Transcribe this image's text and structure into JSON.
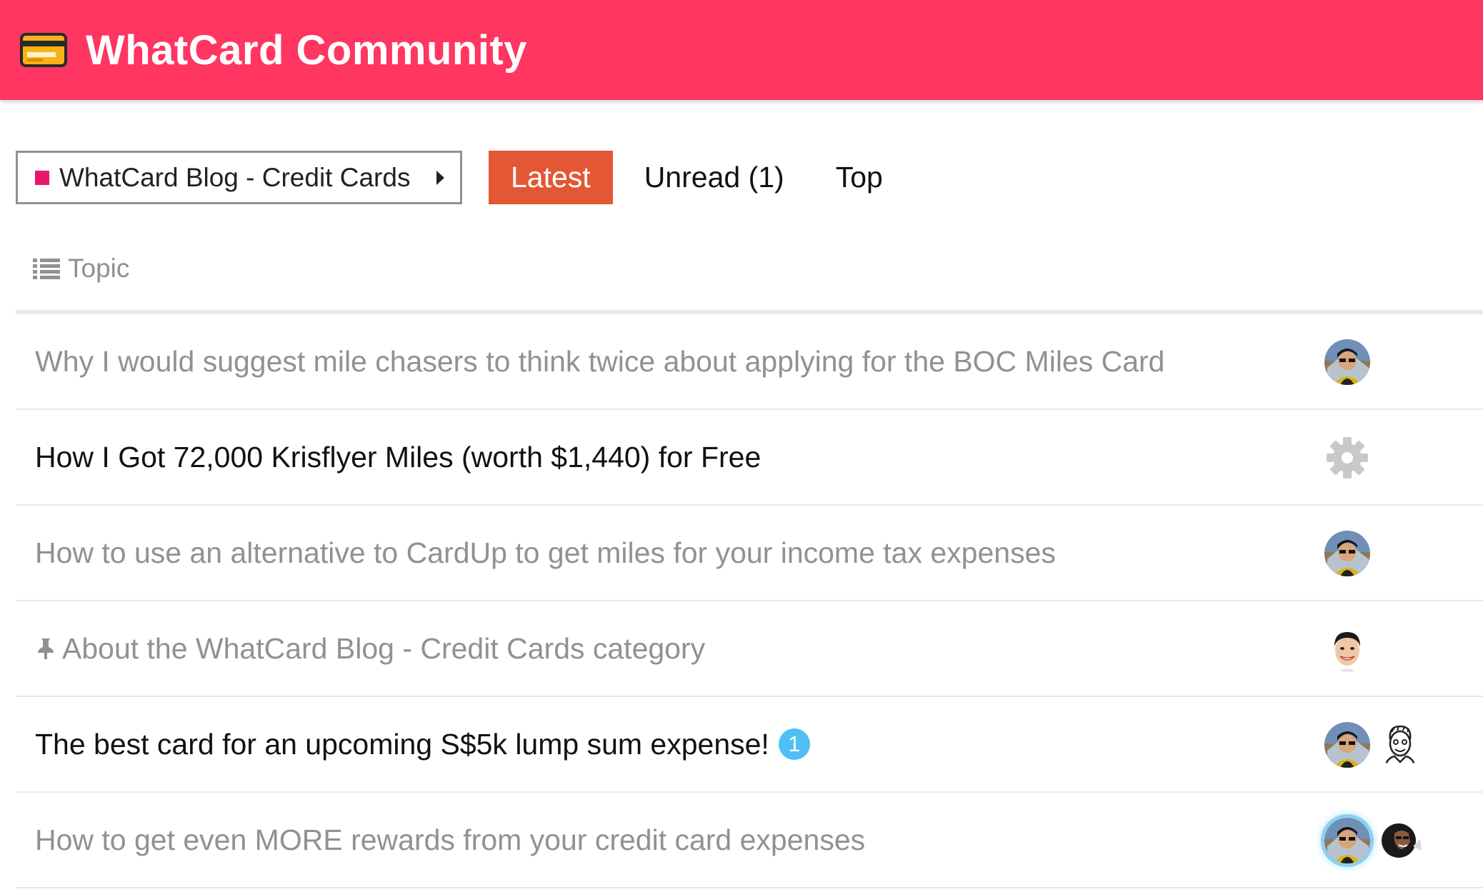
{
  "site": {
    "title": "WhatCard Community",
    "logo_icon": "credit-card-icon",
    "brand_color": "#ff3562"
  },
  "nav": {
    "category": {
      "label": "WhatCard Blog - Credit Cards",
      "color": "#e8186a"
    },
    "tabs": [
      {
        "label": "Latest",
        "active": true
      },
      {
        "label": "Unread (1)",
        "active": false
      },
      {
        "label": "Top",
        "active": false
      }
    ],
    "active_color": "#e45735"
  },
  "table": {
    "column_header": "Topic"
  },
  "topics": [
    {
      "title": "Why I would suggest mile chasers to think twice about applying for the BOC Miles Card",
      "read": true,
      "pinned": false,
      "posters": [
        "avatar-user-sunglasses"
      ]
    },
    {
      "title": "How I Got 72,000 Krisflyer Miles (worth $1,440) for Free",
      "read": false,
      "pinned": false,
      "posters": [
        "system-gear-icon"
      ]
    },
    {
      "title": "How to use an alternative to CardUp to get miles for your income tax expenses",
      "read": true,
      "pinned": false,
      "posters": [
        "avatar-user-sunglasses"
      ]
    },
    {
      "title": "About the WhatCard Blog - Credit Cards category",
      "read": true,
      "pinned": true,
      "posters": [
        "avatar-user-smiling"
      ]
    },
    {
      "title": "The best card for an upcoming S$5k lump sum expense!",
      "read": false,
      "pinned": false,
      "new_replies": "1",
      "badge_color": "#4fbff6",
      "posters": [
        "avatar-user-sunglasses",
        "avatar-user-sketch"
      ]
    },
    {
      "title": "How to get even MORE rewards from your credit card expenses",
      "read": true,
      "pinned": false,
      "posters": [
        "avatar-user-sunglasses",
        "avatar-user-dark"
      ]
    }
  ]
}
